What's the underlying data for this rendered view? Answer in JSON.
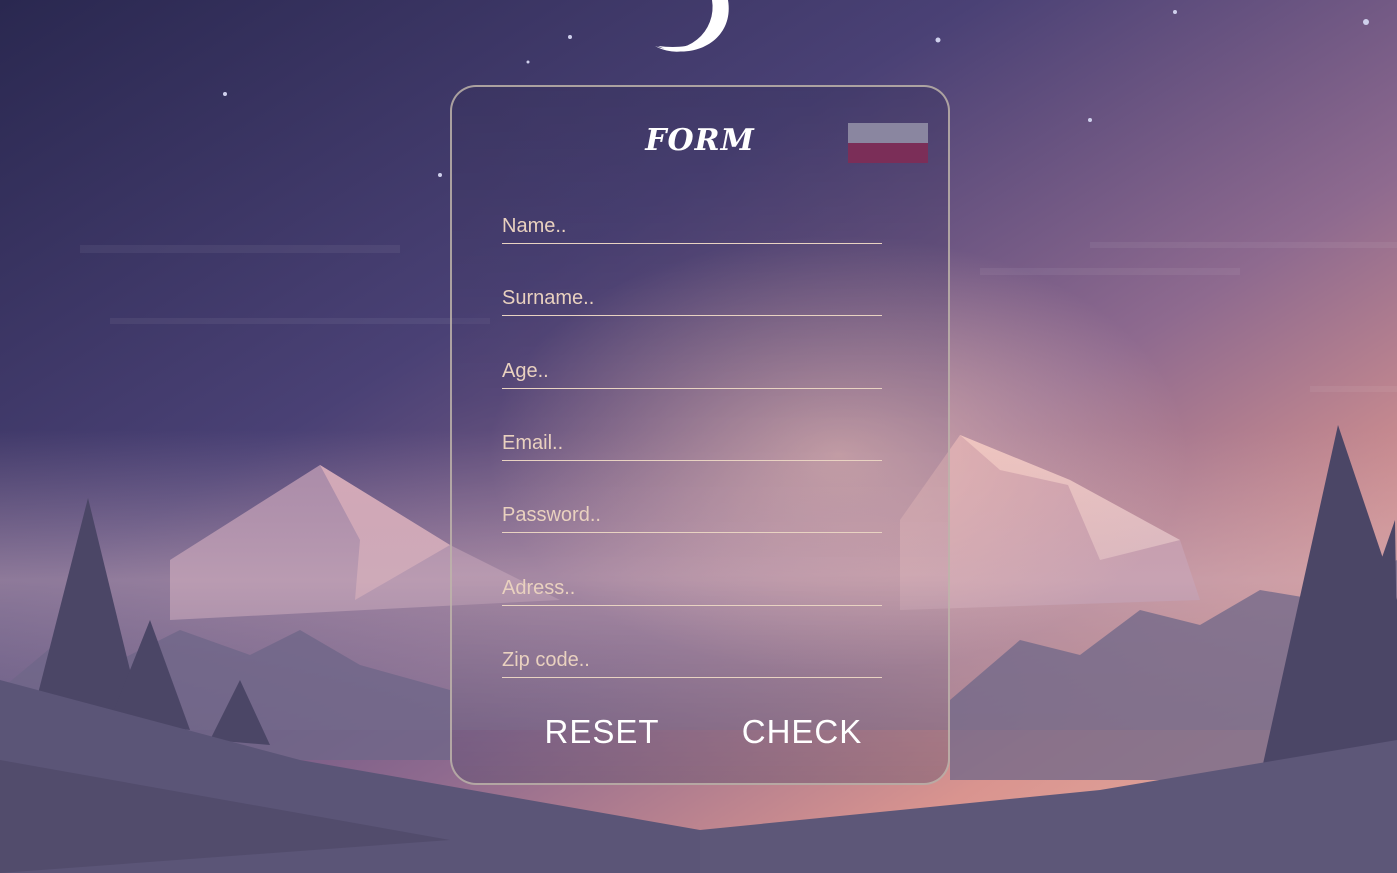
{
  "form": {
    "title": "FORM",
    "fields": {
      "name": {
        "placeholder": "Name..",
        "value": ""
      },
      "surname": {
        "placeholder": "Surname..",
        "value": ""
      },
      "age": {
        "placeholder": "Age..",
        "value": ""
      },
      "email": {
        "placeholder": "Email..",
        "value": ""
      },
      "password": {
        "placeholder": "Password..",
        "value": ""
      },
      "address": {
        "placeholder": "Adress..",
        "value": ""
      },
      "zip": {
        "placeholder": "Zip code..",
        "value": ""
      }
    },
    "buttons": {
      "reset_label": "RESET",
      "check_label": "CHECK"
    },
    "language_flag": {
      "icon": "language-flag-icon",
      "colors": [
        "#8a86a0",
        "#7b2e58"
      ]
    }
  },
  "theme": {
    "sky_top": "#2f2c55",
    "sky_bottom": "#e8a79a",
    "mountain": "#d5a2b0",
    "tree": "#4f4a6a",
    "accent_text": "#f1dccb"
  }
}
